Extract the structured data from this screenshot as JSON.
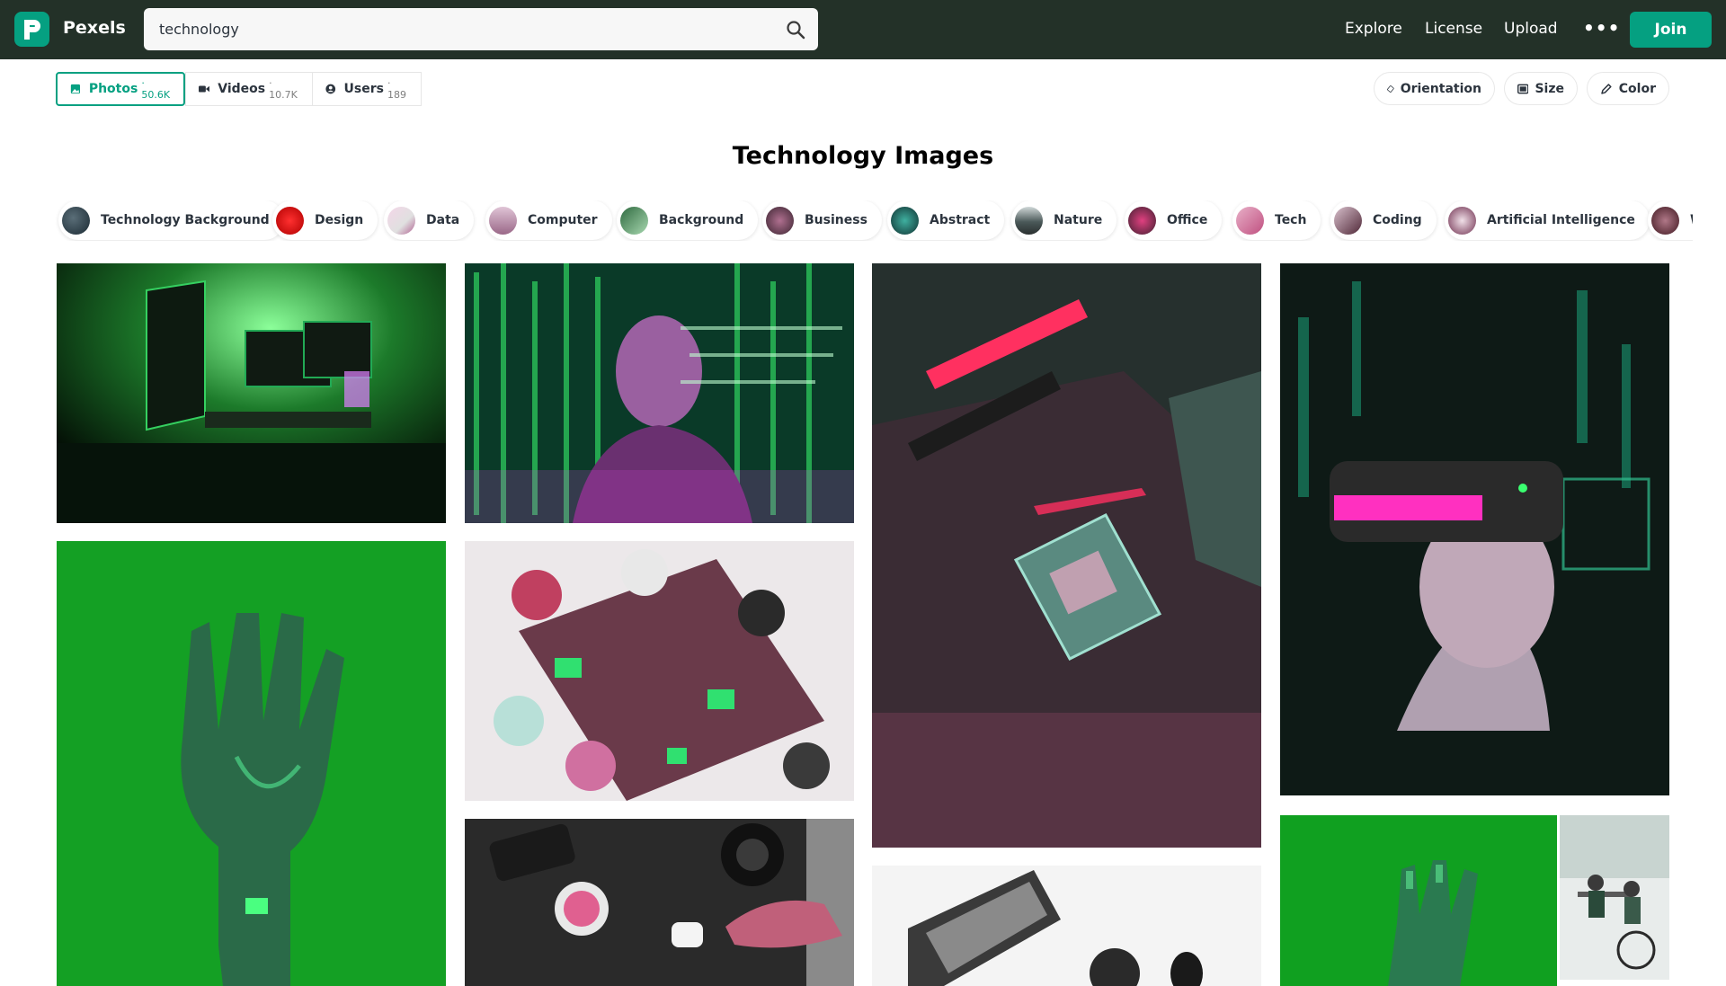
{
  "header": {
    "brand": "Pexels",
    "search_value": "technology",
    "nav": [
      "Explore",
      "License",
      "Upload"
    ],
    "more": "•••",
    "join": "Join"
  },
  "tabs": [
    {
      "label": "Photos",
      "count": "· 50.6K",
      "active": true
    },
    {
      "label": "Videos",
      "count": "· 10.7K",
      "active": false
    },
    {
      "label": "Users",
      "count": "· 189",
      "active": false
    }
  ],
  "filters": [
    "Orientation",
    "Size",
    "Color"
  ],
  "page_title": "Technology Images",
  "chips": [
    "Technology Background",
    "Design",
    "Data",
    "Computer",
    "Background",
    "Business",
    "Abstract",
    "Nature",
    "Office",
    "Tech",
    "Coding",
    "Artificial Intelligence",
    "W"
  ],
  "colors": {
    "topbar": "#233128",
    "accent": "#05a081"
  }
}
